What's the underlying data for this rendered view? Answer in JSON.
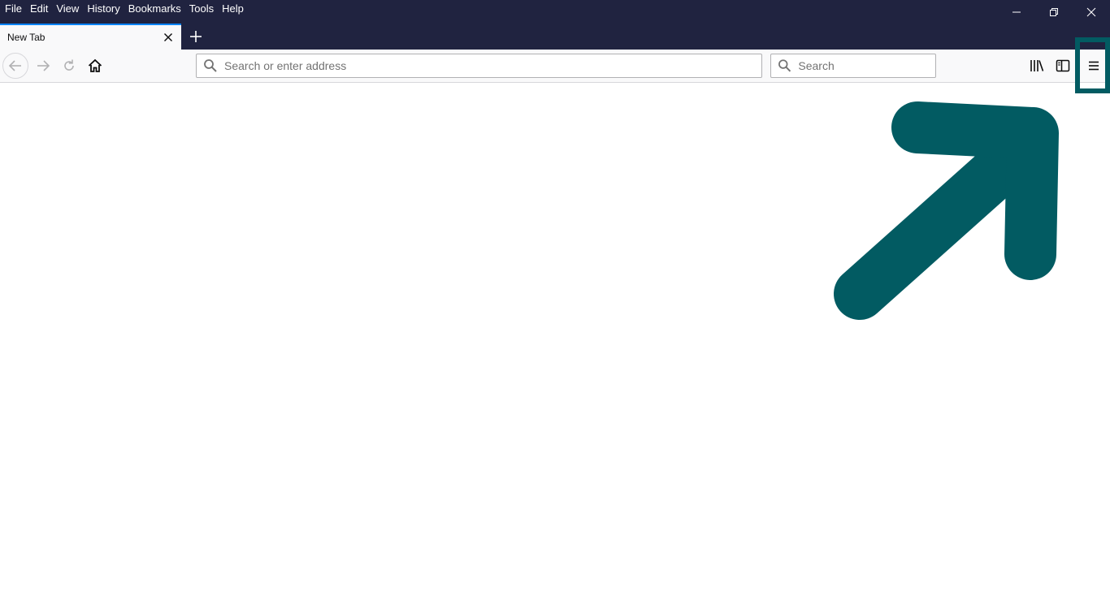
{
  "menubar": {
    "items": [
      {
        "label": "File"
      },
      {
        "label": "Edit"
      },
      {
        "label": "View"
      },
      {
        "label": "History"
      },
      {
        "label": "Bookmarks"
      },
      {
        "label": "Tools"
      },
      {
        "label": "Help"
      }
    ]
  },
  "tabs": [
    {
      "label": "New Tab",
      "active": true
    }
  ],
  "urlbar": {
    "placeholder": "Search or enter address",
    "value": ""
  },
  "searchbar": {
    "placeholder": "Search",
    "value": ""
  },
  "icons": {
    "back": "back-arrow-icon",
    "forward": "forward-arrow-icon",
    "reload": "reload-icon",
    "home": "home-icon",
    "library": "library-icon",
    "sidebar": "sidebar-icon",
    "menu": "hamburger-menu-icon",
    "minimize": "minimize-icon",
    "restore": "restore-icon",
    "close": "close-icon",
    "new_tab": "plus-icon"
  },
  "colors": {
    "titlebar": "#202340",
    "toolbar": "#f9f9fa",
    "annotation": "#025b62",
    "tab_accent": "#0a84ff"
  }
}
